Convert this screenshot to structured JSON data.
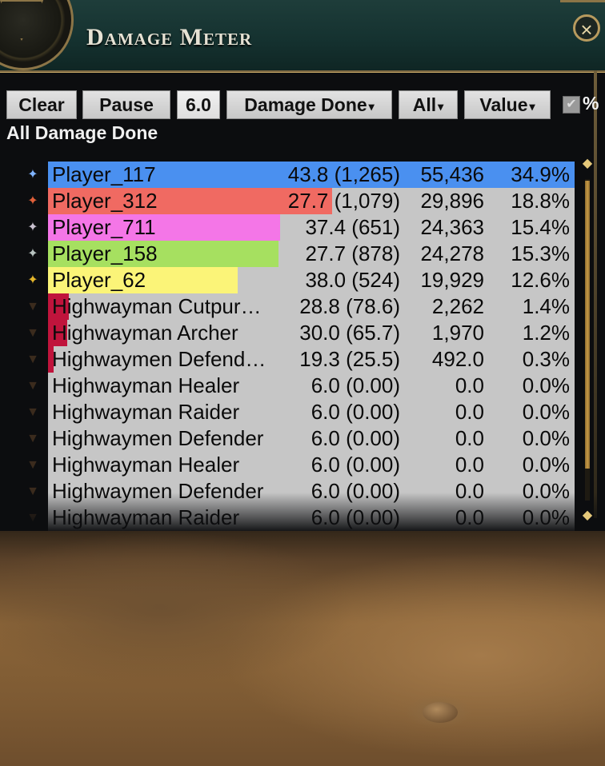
{
  "window": {
    "title": "Damage Meter",
    "close_icon": "close-icon"
  },
  "toolbar": {
    "clear": "Clear",
    "pause": "Pause",
    "number": "6.0",
    "mode": "Damage Done",
    "filter": "All",
    "value": "Value",
    "percent_checked": true,
    "percent_label": "%",
    "caret": "▾"
  },
  "subtitle": "All Damage Done",
  "rows": [
    {
      "name": "Player_117",
      "dps": "43.8 (1,265)",
      "total": "55,436",
      "pct": "34.9%",
      "share": 1.0,
      "color": "#4a90f0",
      "icon": "#7fb3ff"
    },
    {
      "name": "Player_312",
      "dps": "27.7 (1,079)",
      "total": "29,896",
      "pct": "18.8%",
      "share": 0.539,
      "color": "#f06a62",
      "icon": "#e0603a"
    },
    {
      "name": "Player_711",
      "dps": "37.4 (651)",
      "total": "24,363",
      "pct": "15.4%",
      "share": 0.44,
      "color": "#f476e7",
      "icon": "#c9c1cf"
    },
    {
      "name": "Player_158",
      "dps": "27.7 (878)",
      "total": "24,278",
      "pct": "15.3%",
      "share": 0.438,
      "color": "#a6e060",
      "icon": "#b8c3c0"
    },
    {
      "name": "Player_62",
      "dps": "38.0 (524)",
      "total": "19,929",
      "pct": "12.6%",
      "share": 0.36,
      "color": "#fbf478",
      "icon": "#e4b52b"
    },
    {
      "name": "Highwayman Cutpur…",
      "dps": "28.8 (78.6)",
      "total": "2,262",
      "pct": "1.4%",
      "share": 0.041,
      "color": "#c0143c",
      "icon": "#3b2b1d"
    },
    {
      "name": "Highwayman Archer",
      "dps": "30.0 (65.7)",
      "total": "1,970",
      "pct": "1.2%",
      "share": 0.036,
      "color": "#c0143c",
      "icon": "#3b2b1d"
    },
    {
      "name": "Highwaymen Defend…",
      "dps": "19.3 (25.5)",
      "total": "492.0",
      "pct": "0.3%",
      "share": 0.009,
      "color": "#c0143c",
      "icon": "#3b2b1d"
    },
    {
      "name": "Highwayman Healer",
      "dps": "6.0 (0.00)",
      "total": "0.0",
      "pct": "0.0%",
      "share": 0,
      "color": "#c0143c",
      "icon": "#3b2b1d"
    },
    {
      "name": "Highwayman Raider",
      "dps": "6.0 (0.00)",
      "total": "0.0",
      "pct": "0.0%",
      "share": 0,
      "color": "#c0143c",
      "icon": "#3b2b1d"
    },
    {
      "name": "Highwaymen Defender",
      "dps": "6.0 (0.00)",
      "total": "0.0",
      "pct": "0.0%",
      "share": 0,
      "color": "#c0143c",
      "icon": "#3b2b1d"
    },
    {
      "name": "Highwayman Healer",
      "dps": "6.0 (0.00)",
      "total": "0.0",
      "pct": "0.0%",
      "share": 0,
      "color": "#c0143c",
      "icon": "#3b2b1d"
    },
    {
      "name": "Highwaymen Defender",
      "dps": "6.0 (0.00)",
      "total": "0.0",
      "pct": "0.0%",
      "share": 0,
      "color": "#c0143c",
      "icon": "#3b2b1d"
    },
    {
      "name": "Highwayman Raider",
      "dps": "6.0 (0.00)",
      "total": "0.0",
      "pct": "0.0%",
      "share": 0,
      "color": "#c0143c",
      "icon": "#3b2b1d"
    }
  ],
  "scroll": {
    "up_icon": "scroll-up-icon",
    "down_icon": "scroll-down-icon"
  }
}
